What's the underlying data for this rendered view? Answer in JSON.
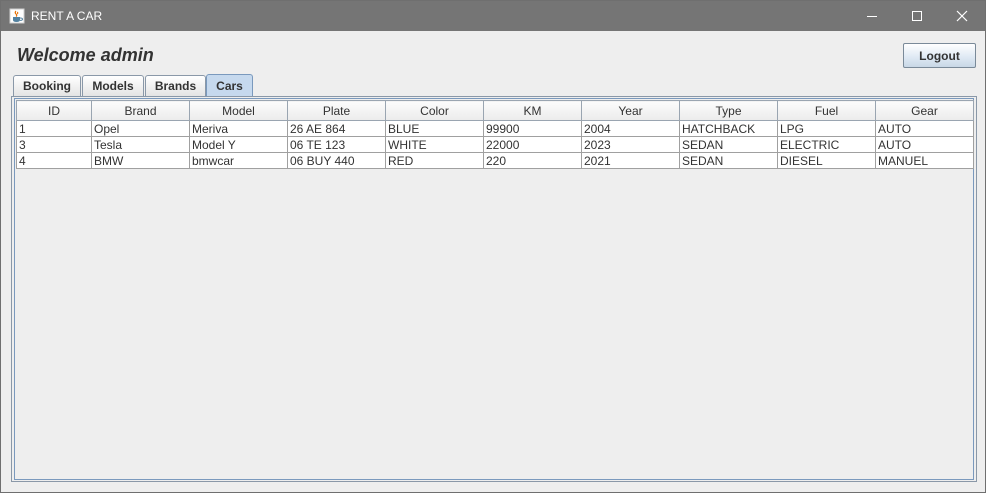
{
  "window": {
    "title": "RENT A CAR"
  },
  "header": {
    "welcome": "Welcome admin",
    "logout_label": "Logout"
  },
  "tabs": [
    {
      "label": "Booking",
      "selected": false
    },
    {
      "label": "Models",
      "selected": false
    },
    {
      "label": "Brands",
      "selected": false
    },
    {
      "label": "Cars",
      "selected": true
    }
  ],
  "table": {
    "columns": [
      "ID",
      "Brand",
      "Model",
      "Plate",
      "Color",
      "KM",
      "Year",
      "Type",
      "Fuel",
      "Gear"
    ],
    "rows": [
      [
        "1",
        "Opel",
        "Meriva",
        "26 AE 864",
        "BLUE",
        "99900",
        "2004",
        "HATCHBACK",
        "LPG",
        "AUTO"
      ],
      [
        "3",
        "Tesla",
        "Model Y",
        "06 TE 123",
        "WHITE",
        "22000",
        "2023",
        "SEDAN",
        "ELECTRIC",
        "AUTO"
      ],
      [
        "4",
        "BMW",
        "bmwcar",
        "06 BUY 440",
        "RED",
        "220",
        "2021",
        "SEDAN",
        "DIESEL",
        "MANUEL"
      ]
    ]
  },
  "icons": {
    "app": "java-cup-icon",
    "minimize": "minimize-icon",
    "maximize": "maximize-icon",
    "close": "close-icon"
  }
}
